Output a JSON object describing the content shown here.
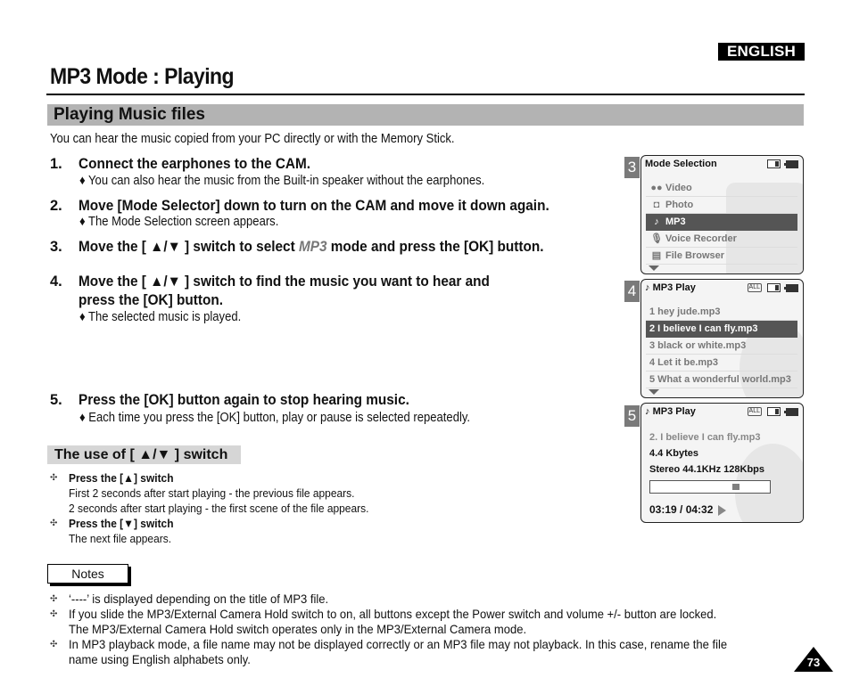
{
  "header": {
    "language": "ENGLISH",
    "title": "MP3 Mode : Playing"
  },
  "section": {
    "title": "Playing Music files",
    "intro": "You can hear the music copied from your PC directly or with the Memory Stick."
  },
  "steps": [
    {
      "num": "1.",
      "text": "Connect the earphones to the CAM.",
      "sub": "♦ You can also hear the music from the Built-in speaker without the earphones."
    },
    {
      "num": "2.",
      "text": "Move [Mode Selector] down to turn on the CAM and move it down again.",
      "sub": "♦ The Mode Selection screen appears."
    },
    {
      "num": "3.",
      "text_before": "Move the [ ▲/▼ ] switch to select ",
      "text_em": "MP3",
      "text_after": " mode and press the [OK] button."
    },
    {
      "num": "4.",
      "text_line1": "Move the [ ▲/▼ ] switch to find the music you want to hear and",
      "text_line2": "press the [OK] button.",
      "sub": "♦ The selected music is played."
    },
    {
      "num": "5.",
      "text": "Press the [OK] button again to stop hearing music.",
      "sub": "♦ Each time you press the [OK] button, play or pause is selected repeatedly."
    }
  ],
  "switch_usage": {
    "title": "The use of [ ▲/▼ ] switch",
    "bullet_icon": "✣",
    "items": [
      {
        "heading": "Press the [▲] switch",
        "lines": [
          "First 2 seconds after start playing - the previous file appears.",
          "2 seconds after start playing - the first scene of the file appears."
        ]
      },
      {
        "heading": "Press the [▼] switch",
        "lines": [
          "The next file appears."
        ]
      }
    ]
  },
  "notes": {
    "label": "Notes",
    "items": [
      {
        "lines": [
          "‘----’ is displayed depending on the title of MP3 file."
        ]
      },
      {
        "lines": [
          "If you slide the MP3/External Camera Hold switch to on, all buttons except the Power switch and volume +/- button are locked.",
          "The MP3/External Camera Hold switch operates only in the MP3/External Camera mode."
        ]
      },
      {
        "lines": [
          "In MP3 playback mode, a file name may not be displayed correctly or an MP3 file may not playback. In this case, rename the file",
          "name using English alphabets only."
        ]
      }
    ]
  },
  "screens": [
    {
      "number": "3",
      "title": "Mode Selection",
      "items": [
        {
          "icon": "video-camera-icon",
          "glyph": "●●",
          "label": "Video",
          "selected": false
        },
        {
          "icon": "camera-icon",
          "glyph": "◘",
          "label": "Photo",
          "selected": false
        },
        {
          "icon": "music-note-icon",
          "glyph": "♪",
          "label": "MP3",
          "selected": true
        },
        {
          "icon": "microphone-icon",
          "glyph": "🎙",
          "label": "Voice Recorder",
          "selected": false
        },
        {
          "icon": "file-icon",
          "glyph": "▤",
          "label": "File Browser",
          "selected": false
        }
      ]
    },
    {
      "number": "4",
      "title": "MP3 Play",
      "repeat_badge": "ALL",
      "items": [
        {
          "label": "1  hey jude.mp3",
          "selected": false
        },
        {
          "label": "2  I believe I can fly.mp3",
          "selected": true
        },
        {
          "label": "3  black or white.mp3",
          "selected": false
        },
        {
          "label": "4  Let it be.mp3",
          "selected": false
        },
        {
          "label": "5  What a wonderful world.mp3",
          "selected": false
        }
      ]
    },
    {
      "number": "5",
      "title": "MP3 Play",
      "repeat_badge": "ALL",
      "track": "2.  I believe I can fly.mp3",
      "size": "4.4 Kbytes",
      "format": "Stereo 44.1KHz 128Kbps",
      "progress_fraction": 0.73,
      "time": "03:19 / 04:32"
    }
  ],
  "page_number": "73"
}
